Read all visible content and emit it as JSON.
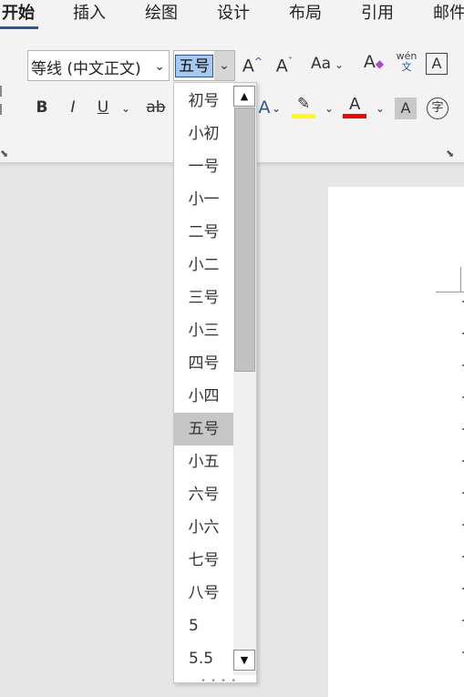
{
  "tabs": [
    {
      "label": "开始",
      "active": true
    },
    {
      "label": "插入",
      "active": false
    },
    {
      "label": "绘图",
      "active": false
    },
    {
      "label": "设计",
      "active": false
    },
    {
      "label": "布局",
      "active": false
    },
    {
      "label": "引用",
      "active": false
    },
    {
      "label": "邮件",
      "active": false
    }
  ],
  "font": {
    "name_value": "等线 (中文正文)",
    "size_value": "五号",
    "grow_label": "A",
    "shrink_label": "A",
    "case_label": "Aa",
    "phonetic_top": "wén",
    "phonetic_bottom": "文",
    "border_char_label": "A",
    "bold_label": "B",
    "italic_label": "I",
    "underline_label": "U",
    "strike_label": "ab",
    "font_color_label": "A",
    "shading_label": "A",
    "enclose_label": "字",
    "highlight_color": "#ffff00",
    "font_color": "#ff0000"
  },
  "size_options": [
    {
      "label": "初号"
    },
    {
      "label": "小初"
    },
    {
      "label": "一号"
    },
    {
      "label": "小一"
    },
    {
      "label": "二号"
    },
    {
      "label": "小二"
    },
    {
      "label": "三号"
    },
    {
      "label": "小三"
    },
    {
      "label": "四号"
    },
    {
      "label": "小四"
    },
    {
      "label": "五号",
      "selected": true
    },
    {
      "label": "小五"
    },
    {
      "label": "六号"
    },
    {
      "label": "小六"
    },
    {
      "label": "七号"
    },
    {
      "label": "八号"
    },
    {
      "label": "5"
    },
    {
      "label": "5.5"
    }
  ]
}
